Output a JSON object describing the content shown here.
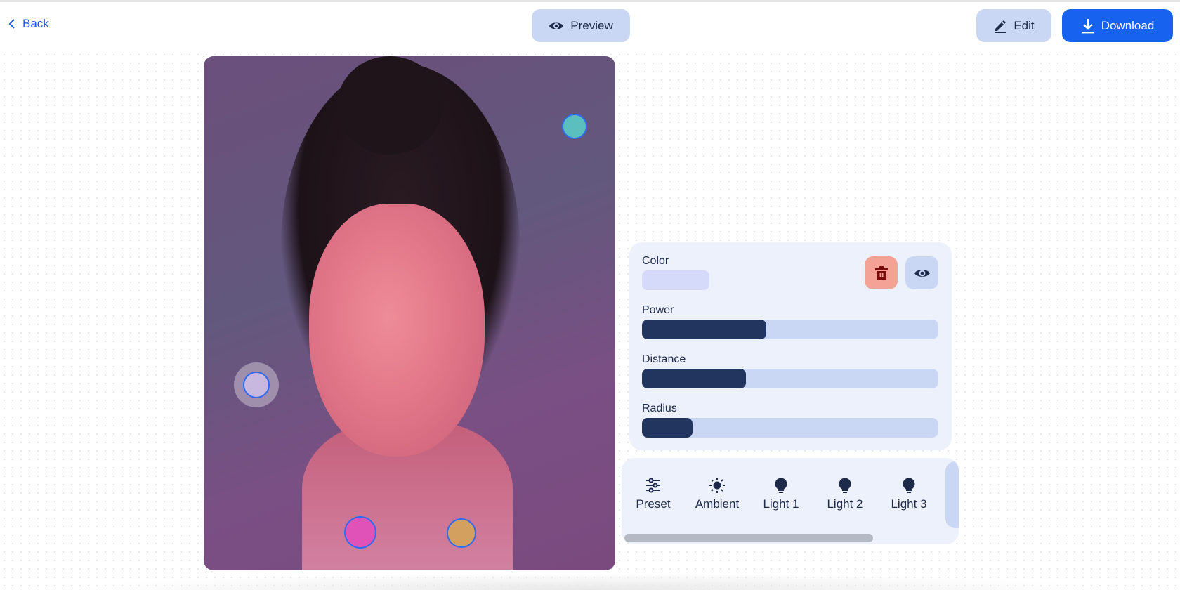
{
  "header": {
    "back_label": "Back",
    "preview_label": "Preview",
    "edit_label": "Edit",
    "download_label": "Download"
  },
  "light_panel": {
    "color_label": "Color",
    "color_value": "#d5d9fa",
    "power_label": "Power",
    "power_value": 0.42,
    "distance_label": "Distance",
    "distance_value": 0.35,
    "radius_label": "Radius",
    "radius_value": 0.17
  },
  "tabs": [
    {
      "label": "Preset",
      "icon": "sliders-icon"
    },
    {
      "label": "Ambient",
      "icon": "sun-icon"
    },
    {
      "label": "Light 1",
      "icon": "bulb-icon"
    },
    {
      "label": "Light 2",
      "icon": "bulb-icon"
    },
    {
      "label": "Light 3",
      "icon": "bulb-icon"
    }
  ],
  "light_handles": [
    {
      "color": "#5bbfbf"
    },
    {
      "color": "#c8b8e0"
    },
    {
      "color": "#e052b8"
    },
    {
      "color": "#d4a060"
    }
  ],
  "colors": {
    "accent": "#1763f0",
    "delete": "#f4a196",
    "slider_fill": "#22355e"
  }
}
